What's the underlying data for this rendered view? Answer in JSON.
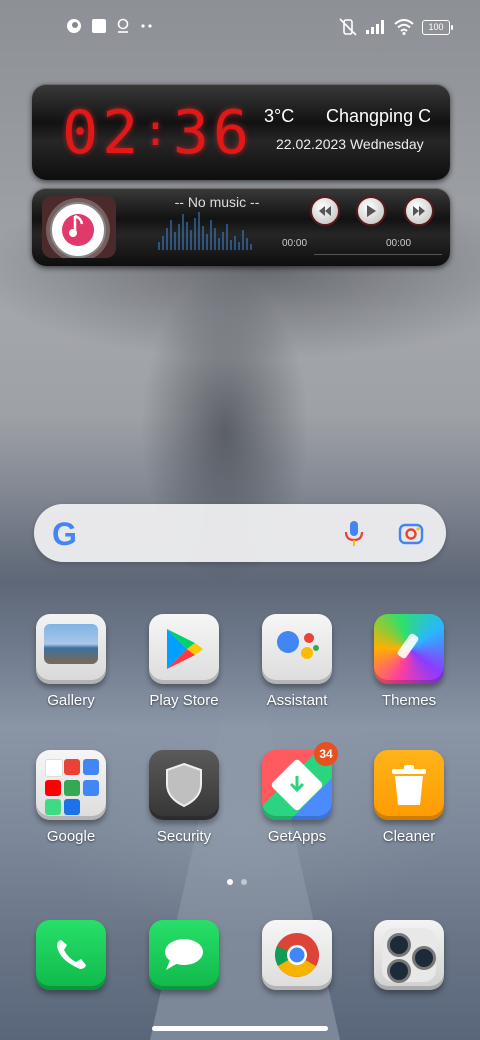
{
  "status_bar": {
    "battery": "100"
  },
  "clock_widget": {
    "hours": "02",
    "minutes": "36",
    "temperature": "3°C",
    "city": "Changping C",
    "date": "22.02.2023 Wednesday"
  },
  "music_widget": {
    "title": "-- No music --",
    "elapsed": "00:00",
    "duration": "00:00"
  },
  "search": {
    "logo": "G"
  },
  "apps_row1": [
    {
      "label": "Gallery"
    },
    {
      "label": "Play Store"
    },
    {
      "label": "Assistant"
    },
    {
      "label": "Themes"
    }
  ],
  "apps_row2": [
    {
      "label": "Google"
    },
    {
      "label": "Security"
    },
    {
      "label": "GetApps",
      "badge": "34"
    },
    {
      "label": "Cleaner"
    }
  ],
  "dock": [
    {
      "icon": "phone-icon"
    },
    {
      "icon": "messages-icon"
    },
    {
      "icon": "chrome-icon"
    },
    {
      "icon": "camera-icon"
    }
  ],
  "page_indicator": {
    "current": 1,
    "total": 2
  }
}
